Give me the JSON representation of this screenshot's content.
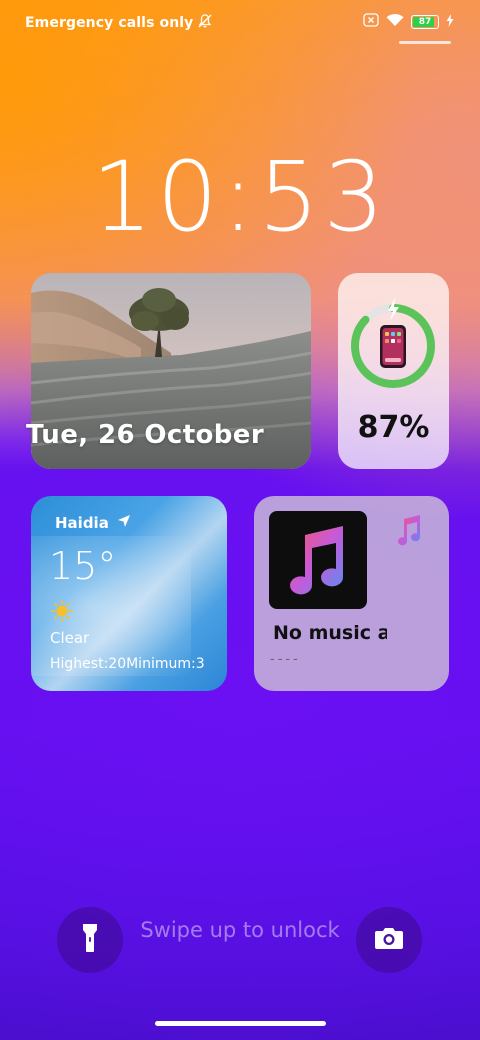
{
  "status_bar": {
    "carrier": "Emergency calls only",
    "battery_level": "87",
    "icons": [
      "bell-off-icon",
      "sim-off-icon",
      "wifi-icon",
      "battery-icon",
      "charging-bolt-icon"
    ]
  },
  "clock": {
    "time": "10:53"
  },
  "photo_widget": {
    "date": "Tue, 26 October"
  },
  "battery_widget": {
    "percent": "87%",
    "level": 0.87,
    "ring_color": "#5cc35a"
  },
  "weather_widget": {
    "city": "Haidia",
    "temperature": "15°",
    "condition": "Clear",
    "range": "Highest:20Minimum:3",
    "icons": [
      "location-arrow-icon",
      "sun-icon"
    ]
  },
  "music_widget": {
    "title": "No music a",
    "artist": "----",
    "icons": [
      "music-note-icon",
      "music-note-small-icon"
    ]
  },
  "bottom": {
    "unlock_hint": "Swipe up to unlock",
    "icons": [
      "flashlight-icon",
      "camera-icon"
    ]
  },
  "colors": {
    "accent_purple": "#650ef1",
    "wallpaper_orange": "#ff9b17",
    "battery_green": "#2bd14d"
  }
}
